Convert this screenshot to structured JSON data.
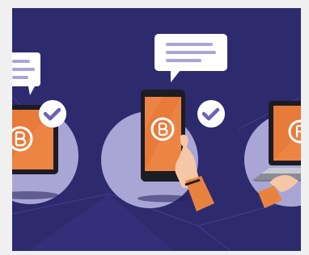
{
  "colors": {
    "background": "#f0f0f0",
    "scene_bg": "#2e2a6e",
    "scene_bg_light": "#3a3684",
    "circle": "#a9a6d6",
    "device_dark": "#1c1c24",
    "screen_orange": "#e87a3a",
    "logo_ring": "#ffffff",
    "bubble": "#ffffff",
    "bubble_lines": "#a9a6d6",
    "check_badge": "#ffffff",
    "check_mark": "#6a63b6",
    "skin": "#f4c7a6",
    "sleeve": "#e8833f",
    "shadow": "#23205a"
  },
  "icons": {
    "logo": "b-logo-icon",
    "check": "check-circle-icon",
    "message": "speech-bubble-icon"
  },
  "devices": [
    {
      "kind": "tablet",
      "state": "verified"
    },
    {
      "kind": "phone",
      "state": "verified"
    },
    {
      "kind": "laptop",
      "state": "in-use"
    }
  ]
}
